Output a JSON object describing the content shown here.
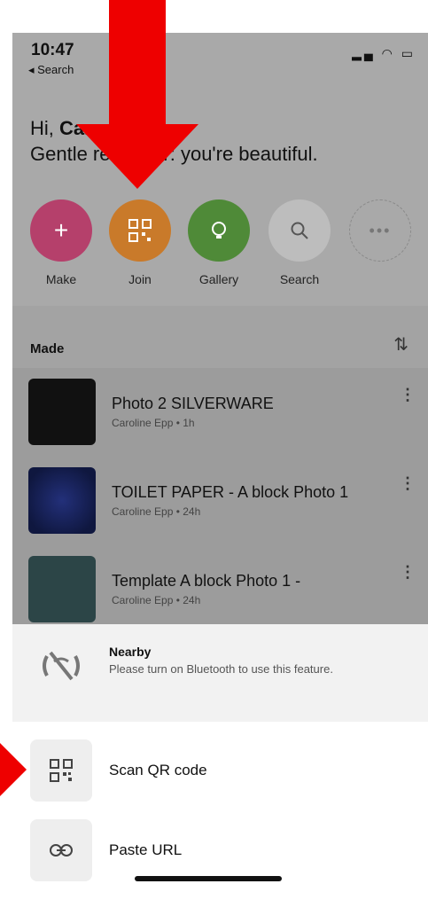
{
  "status": {
    "time": "10:47",
    "back_label": "◂ Search"
  },
  "greeting": {
    "hi": "Hi,",
    "name": "Caro",
    "message": "Gentle reminder: you're beautiful."
  },
  "actions": [
    {
      "label": "Make",
      "icon": "plus-icon",
      "color": "#b5406b"
    },
    {
      "label": "Join",
      "icon": "qr-icon",
      "color": "#c97a2a"
    },
    {
      "label": "Gallery",
      "icon": "lightbulb-icon",
      "color": "#4f8a38"
    },
    {
      "label": "Search",
      "icon": "search-icon",
      "color": "#bdbdbd"
    },
    {
      "label": "",
      "icon": "more-icon",
      "color": "#a9a9a9"
    }
  ],
  "made": {
    "title": "Made",
    "items": [
      {
        "title": "Photo 2 SILVERWARE",
        "subtitle": "Caroline Epp • 1h"
      },
      {
        "title": "TOILET PAPER -  A block Photo 1",
        "subtitle": "Caroline Epp • 24h"
      },
      {
        "title": "Template A block Photo 1 -",
        "subtitle": "Caroline Epp • 24h"
      }
    ]
  },
  "nearby": {
    "title": "Nearby",
    "subtitle": "Please turn on Bluetooth to use this feature."
  },
  "options": [
    {
      "label": "Scan QR code",
      "icon": "qr-code-icon"
    },
    {
      "label": "Paste URL",
      "icon": "link-icon"
    }
  ]
}
